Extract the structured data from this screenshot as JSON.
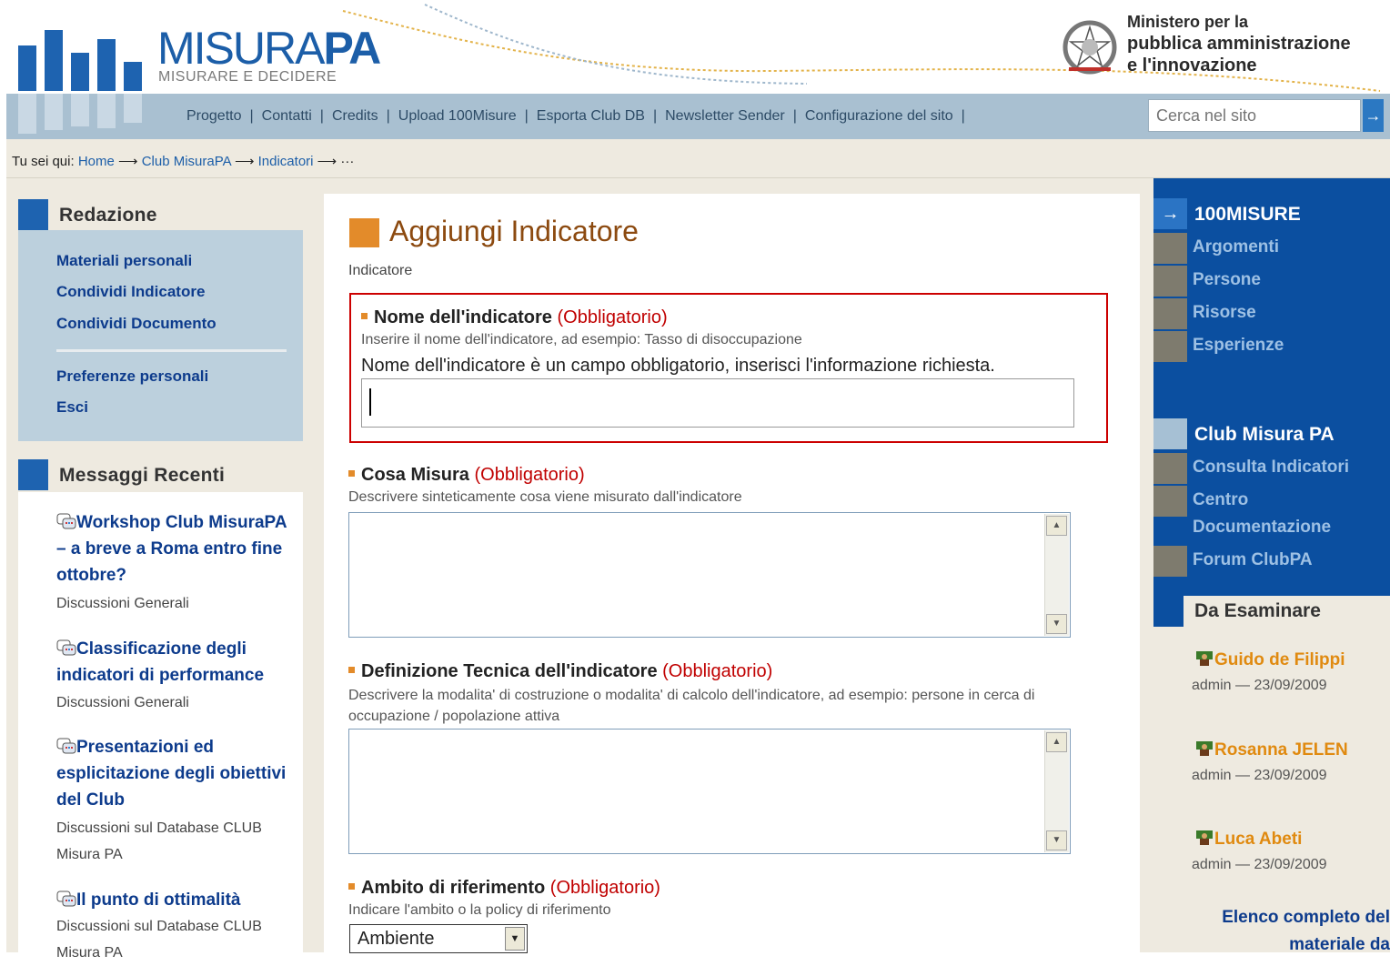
{
  "header": {
    "logo_brand_light": "MISURA",
    "logo_brand_bold": "PA",
    "logo_tagline": "MISURARE E DECIDERE",
    "ministry_line1": "Ministero per la",
    "ministry_line2": "pubblica amministrazione",
    "ministry_line3": "e l'innovazione"
  },
  "nav": {
    "items": [
      "Progetto",
      "Contatti",
      "Credits",
      "Upload 100Misure",
      "Esporta Club DB",
      "Newsletter Sender",
      "Configurazione del sito"
    ],
    "search_placeholder": "Cerca nel sito"
  },
  "breadcrumb": {
    "prefix": "Tu sei qui:",
    "items": [
      "Home",
      "Club MisuraPA",
      "Indicatori"
    ],
    "ellipsis": "···"
  },
  "redazione": {
    "title": "Redazione",
    "links": [
      "Materiali personali",
      "Condividi Indicatore",
      "Condividi Documento",
      "Preferenze personali",
      "Esci"
    ]
  },
  "messaggi": {
    "title": "Messaggi Recenti",
    "items": [
      {
        "title": "Workshop Club MisuraPA – a breve a Roma entro fine ottobre?",
        "category": "Discussioni Generali"
      },
      {
        "title": "Classificazione degli indicatori di performance",
        "category": "Discussioni Generali"
      },
      {
        "title": "Presentazioni ed esplicitazione degli obiettivi del Club",
        "category": "Discussioni sul Database CLUB Misura PA"
      },
      {
        "title": "Il punto di ottimalità",
        "category": "Discussioni sul Database CLUB Misura PA"
      }
    ]
  },
  "form": {
    "title": "Aggiungi Indicatore",
    "subtitle": "Indicatore",
    "required_text": "(Obbligatorio)",
    "nome": {
      "label": "Nome dell'indicatore",
      "help": "Inserire il nome dell'indicatore, ad esempio: Tasso di disoccupazione",
      "error": "Nome dell'indicatore è un campo obbligatorio, inserisci l'informazione richiesta.",
      "value": ""
    },
    "cosa": {
      "label": "Cosa Misura",
      "help": "Descrivere sinteticamente cosa viene misurato dall'indicatore"
    },
    "definizione": {
      "label": "Definizione Tecnica dell'indicatore",
      "help": "Descrivere la modalita' di costruzione o modalita' di calcolo dell'indicatore, ad esempio: persone in cerca di occupazione / popolazione attiva"
    },
    "ambito": {
      "label": "Ambito di riferimento",
      "help": "Indicare l'ambito o la policy di riferimento",
      "selected": "Ambiente"
    }
  },
  "right": {
    "section1": "100MISURE",
    "section1_items": [
      "Argomenti",
      "Persone",
      "Risorse",
      "Esperienze"
    ],
    "section2": "Club Misura PA",
    "section2_items": [
      "Consulta Indicatori",
      "Centro Documentazione",
      "Forum ClubPA"
    ],
    "review_title": "Da Esaminare",
    "reviews": [
      {
        "name": "Guido de Filippi",
        "meta": "admin — 23/09/2009"
      },
      {
        "name": "Rosanna JELEN",
        "meta": "admin — 23/09/2009"
      },
      {
        "name": "Luca Abeti",
        "meta": "admin — 23/09/2009"
      }
    ],
    "elenco_line1": "Elenco completo del",
    "elenco_line2": "materiale da"
  },
  "colors": {
    "brand_blue": "#1e63b0",
    "nav_bg": "#a9c0d1",
    "accent_orange": "#e38b2a",
    "error_red": "#cc0000",
    "right_col_blue": "#0b4fa0"
  }
}
